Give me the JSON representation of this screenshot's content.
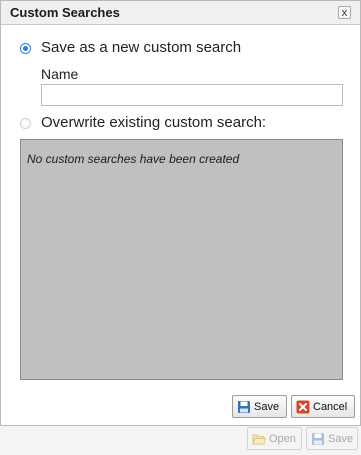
{
  "dialog": {
    "title": "Custom Searches",
    "close_glyph": "x",
    "option_new": {
      "label": "Save as a new custom search",
      "selected": true
    },
    "name_field": {
      "label": "Name",
      "value": "",
      "placeholder": ""
    },
    "option_overwrite": {
      "label": "Overwrite existing custom search:",
      "selected": false
    },
    "list": {
      "empty_message": "No custom searches have been created"
    },
    "buttons": {
      "save_label": "Save",
      "cancel_label": "Cancel"
    }
  },
  "footer": {
    "buttons": {
      "open_label": "Open",
      "save_label": "Save"
    }
  },
  "icons": {
    "save": "floppy-disk-icon",
    "cancel": "cancel-x-icon",
    "open": "folder-open-icon"
  },
  "colors": {
    "accent": "#2a7fd8",
    "list_bg": "#c0c0c0",
    "cancel_red": "#d9452b"
  }
}
